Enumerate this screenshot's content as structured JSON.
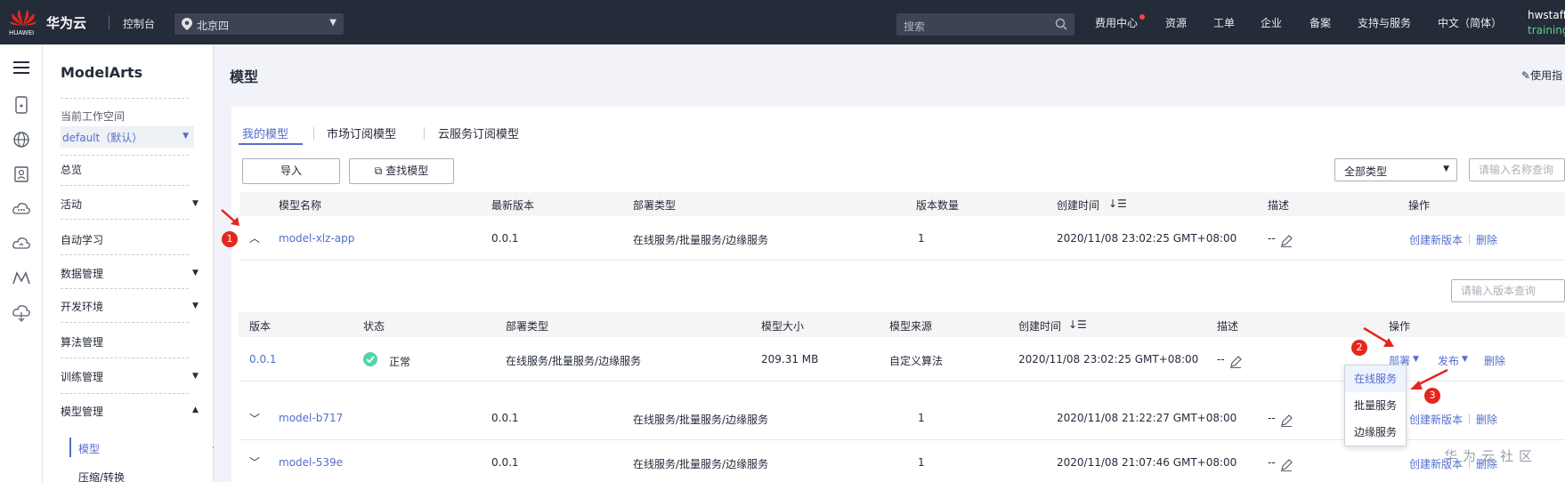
{
  "topbar": {
    "logo_text": "HUAWEI",
    "brand": "华为云",
    "console": "控制台",
    "region": "北京四",
    "search_placeholder": "搜索",
    "nav": [
      "费用中心",
      "资源",
      "工单",
      "企业",
      "备案",
      "支持与服务",
      "中文（简体）"
    ],
    "user_line1": "hwstaff",
    "user_line2": "training"
  },
  "sidemenu": {
    "title": "ModelArts",
    "workspace_label": "当前工作空间",
    "workspace_value": "default（默认）",
    "items": [
      "总览",
      "活动",
      "自动学习",
      "数据管理",
      "开发环境",
      "算法管理",
      "训练管理",
      "模型管理"
    ],
    "subitems": [
      "模型",
      "压缩/转换"
    ]
  },
  "page": {
    "title": "模型",
    "guide": "使用指"
  },
  "tabs": [
    "我的模型",
    "市场订阅模型",
    "云服务订阅模型"
  ],
  "toolbar": {
    "import_label": "导入",
    "find_label": "查找模型",
    "type_select": "全部类型",
    "name_search_placeholder": "请输入名称查询"
  },
  "table": {
    "columns": [
      "模型名称",
      "最新版本",
      "部署类型",
      "版本数量",
      "创建时间",
      "描述",
      "操作"
    ],
    "rows": [
      {
        "name": "model-xlz-app",
        "version": "0.0.1",
        "deploy": "在线服务/批量服务/边缘服务",
        "count": "1",
        "created": "2020/11/08 23:02:25 GMT+08:00",
        "desc": "--",
        "op1": "创建新版本",
        "op2": "删除"
      },
      {
        "name": "model-b717",
        "version": "0.0.1",
        "deploy": "在线服务/批量服务/边缘服务",
        "count": "1",
        "created": "2020/11/08 21:22:27 GMT+08:00",
        "desc": "--",
        "op1": "创建新版本",
        "op2": "删除"
      },
      {
        "name": "model-539e",
        "version": "0.0.1",
        "deploy": "在线服务/批量服务/边缘服务",
        "count": "1",
        "created": "2020/11/08 21:07:46 GMT+08:00",
        "desc": "--",
        "op1": "创建新版本",
        "op2": "删除"
      }
    ]
  },
  "subtable": {
    "search_placeholder": "请输入版本查询",
    "columns": [
      "版本",
      "状态",
      "部署类型",
      "模型大小",
      "模型来源",
      "创建时间",
      "描述",
      "操作"
    ],
    "row": {
      "version": "0.0.1",
      "status": "正常",
      "deploy": "在线服务/批量服务/边缘服务",
      "size": "209.31 MB",
      "source": "自定义算法",
      "created": "2020/11/08 23:02:25 GMT+08:00",
      "desc": "--",
      "op_deploy": "部署",
      "op_publish": "发布",
      "op_delete": "删除"
    }
  },
  "dropdown": {
    "options": [
      "在线服务",
      "批量服务",
      "边缘服务"
    ]
  },
  "annotations": [
    "1",
    "2",
    "3"
  ],
  "watermark": "华为云社区",
  "colors": {
    "accent": "#526ecc",
    "topbar": "#242b39",
    "annotation": "#e3271d",
    "success": "#50d4ab"
  }
}
